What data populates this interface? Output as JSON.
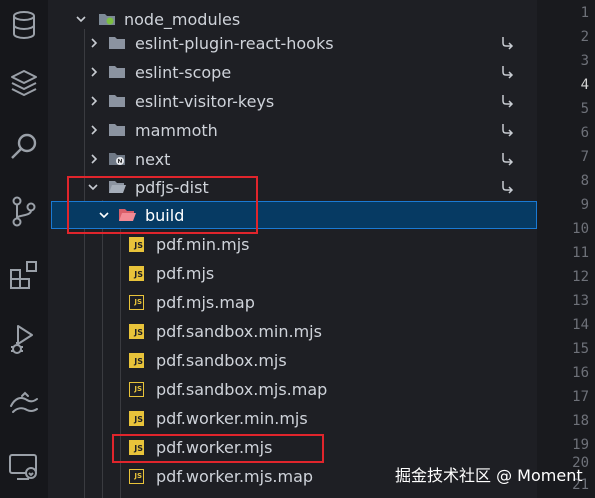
{
  "explorer": {
    "items": [
      {
        "label": "node_modules",
        "type": "folder",
        "expanded": true
      },
      {
        "label": "eslint-plugin-react-hooks",
        "type": "folder",
        "expanded": false
      },
      {
        "label": "eslint-scope",
        "type": "folder",
        "expanded": false
      },
      {
        "label": "eslint-visitor-keys",
        "type": "folder",
        "expanded": false
      },
      {
        "label": "mammoth",
        "type": "folder",
        "expanded": false
      },
      {
        "label": "next",
        "type": "folder",
        "expanded": false
      },
      {
        "label": "pdfjs-dist",
        "type": "folder",
        "expanded": true
      },
      {
        "label": "build",
        "type": "folder",
        "expanded": true,
        "selected": true
      },
      {
        "label": "pdf.min.mjs",
        "type": "js"
      },
      {
        "label": "pdf.mjs",
        "type": "js"
      },
      {
        "label": "pdf.mjs.map",
        "type": "map"
      },
      {
        "label": "pdf.sandbox.min.mjs",
        "type": "js"
      },
      {
        "label": "pdf.sandbox.mjs",
        "type": "js"
      },
      {
        "label": "pdf.sandbox.mjs.map",
        "type": "map"
      },
      {
        "label": "pdf.worker.min.mjs",
        "type": "js"
      },
      {
        "label": "pdf.worker.mjs",
        "type": "js",
        "highlighted": true
      },
      {
        "label": "pdf.worker.mjs.map",
        "type": "map"
      }
    ],
    "js_badge": "JS"
  },
  "gutter": {
    "line_numbers": [
      "1",
      "2",
      "3",
      "4",
      "5",
      "6",
      "7",
      "8",
      "9",
      "10",
      "11",
      "12",
      "13",
      "14",
      "15",
      "16",
      "17",
      "18",
      "19",
      "20",
      "21"
    ],
    "active_line": "4"
  },
  "activity_bar": {
    "icons": [
      "database-icon",
      "layers-icon",
      "search-icon",
      "source-control-icon",
      "extensions-icon",
      "run-debug-icon",
      "docker-icon",
      "remote-explorer-icon"
    ]
  },
  "watermark": "掘金技术社区 @ Moment",
  "colors": {
    "selection_bg": "#063a63",
    "selection_border": "#1a7ad4",
    "highlight_red": "#e0252c",
    "js_yellow": "#e8c33a",
    "folder_grey": "#8b93a0",
    "folder_open_pink": "#e8707a"
  }
}
